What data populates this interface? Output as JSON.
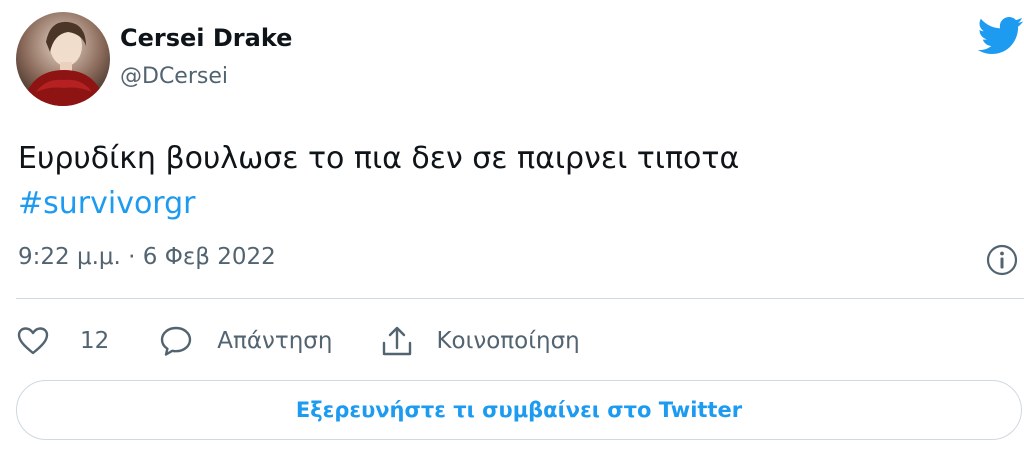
{
  "user": {
    "display_name": "Cersei Drake",
    "handle": "@DCersei"
  },
  "tweet": {
    "text": "Ευρυδίκη βουλωσε το πια δεν σε παιρνει τιποτα",
    "hashtag": "#survivorgr",
    "timestamp": "9:22 μ.μ. · 6 Φεβ 2022"
  },
  "actions": {
    "like_count": "12",
    "reply_label": "Απάντηση",
    "share_label": "Κοινοποίηση"
  },
  "cta": {
    "label": "Εξερευνήστε τι συμβαίνει στο Twitter"
  },
  "icons": {
    "brand": "twitter-bird-icon",
    "info": "info-icon",
    "like": "heart-icon",
    "reply": "speech-bubble-icon",
    "share": "share-icon"
  },
  "colors": {
    "accent": "#1d9bf0",
    "text": "#0f1419",
    "secondary_text": "#536471",
    "border": "#cfd9de"
  }
}
